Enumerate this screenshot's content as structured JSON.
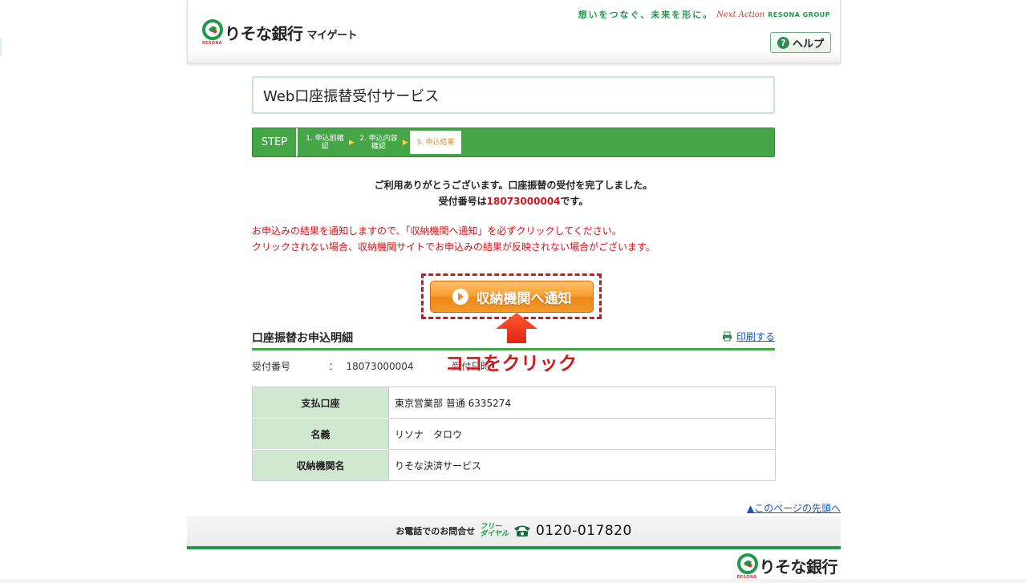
{
  "header": {
    "bank_name": "りそな銀行",
    "app_name": "マイゲート",
    "logo_sub": "RESONA",
    "tagline": "想いをつなぐ、未来を形に。",
    "tagline_next": "Next Action",
    "tagline_group": "RESONA GROUP",
    "help_label": "ヘルプ"
  },
  "page_title": "Web口座振替受付サービス",
  "steps": {
    "label": "STEP",
    "items": [
      {
        "label": "1. 申込前確認"
      },
      {
        "label": "2. 申込内容確認"
      },
      {
        "label": "3. 申込結果"
      }
    ]
  },
  "message": {
    "line1": "ご利用ありがとうございます。口座振替の受付を完了しました。",
    "line2_prefix": "受付番号は",
    "line2_number": "18073000004",
    "line2_suffix": "です。"
  },
  "notice": {
    "line1": "お申込みの結果を通知しますので、「収納機関へ通知」を必ずクリックしてください。",
    "line2": "クリックされない場合、収納機関サイトでお申込みの結果が反映されない場合がございます。"
  },
  "notify_button": {
    "label": "収納機関へ通知"
  },
  "annotation": "ココをクリック",
  "detail": {
    "title": "口座振替お申込明細",
    "print_label": "印刷する",
    "receipt_no_label": "受付番号",
    "receipt_sep": "：",
    "receipt_no": "18073000004",
    "receipt_date_label": "受付日時",
    "rows": [
      {
        "label": "支払口座",
        "value": "東京営業部 普通 6335274"
      },
      {
        "label": "名義",
        "value": "リソナ　タロウ"
      },
      {
        "label": "収納機関名",
        "value": "りそな決済サービス"
      }
    ]
  },
  "page_top_link": "▲このページの先頭へ",
  "footer": {
    "contact_label": "お電話でのお問合せ",
    "free_dial_1": "フリー",
    "free_dial_2": "ダイヤル",
    "phone": "0120-017820",
    "bank_name": "りそな銀行",
    "logo_sub": "RESONA"
  },
  "colors": {
    "brand_green": "#46a546",
    "alert_red": "#d4141a",
    "button_orange": "#f29a2c",
    "link_blue": "#1a55b5"
  }
}
